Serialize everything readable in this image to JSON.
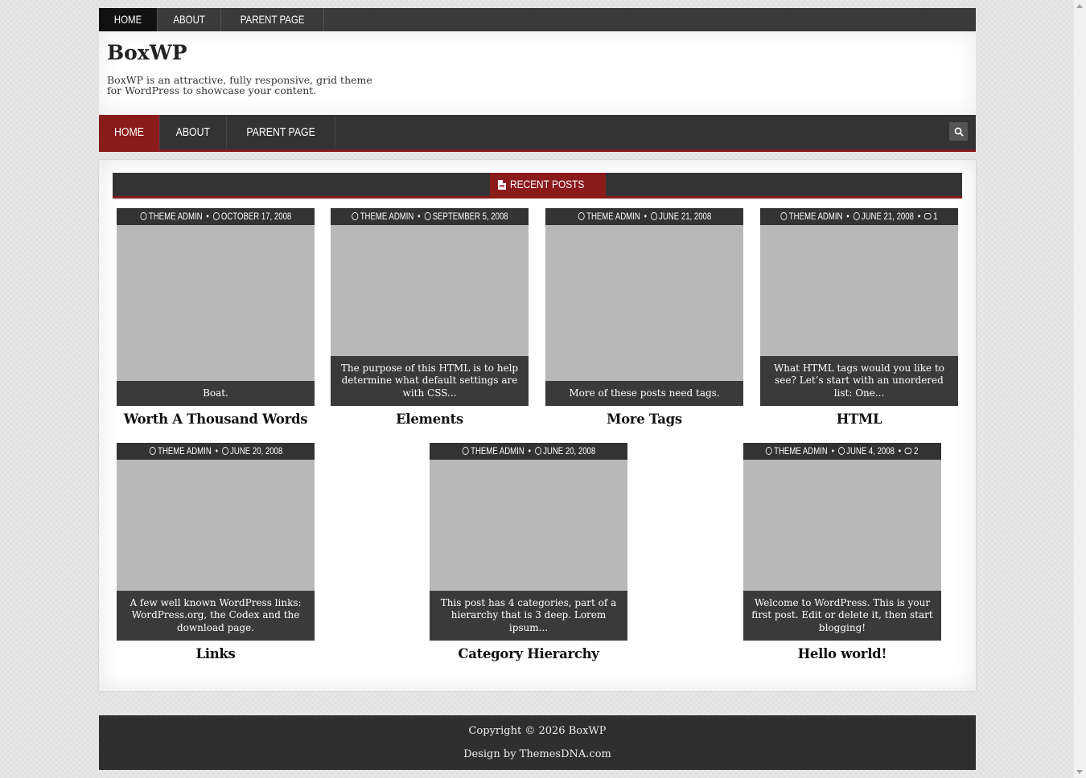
{
  "top_nav": {
    "items": [
      "HOME",
      "ABOUT",
      "PARENT PAGE"
    ]
  },
  "header": {
    "title": "BoxWP",
    "description": "BoxWP is an attractive, fully responsive, grid theme for WordPress to showcase your content."
  },
  "main_nav": {
    "items": [
      "HOME",
      "ABOUT",
      "PARENT PAGE"
    ],
    "search_icon": "search-icon"
  },
  "section": {
    "title": "RECENT POSTS",
    "icon": "document-icon"
  },
  "posts": [
    {
      "author": "THEME ADMIN",
      "date": "OCTOBER 17, 2008",
      "comments": "",
      "excerpt": "Boat.",
      "title": "Worth A Thousand Words"
    },
    {
      "author": "THEME ADMIN",
      "date": "SEPTEMBER 5, 2008",
      "comments": "",
      "excerpt": "The purpose of this HTML is to help determine what default settings are with CSS...",
      "title": "Elements"
    },
    {
      "author": "THEME ADMIN",
      "date": "JUNE 21, 2008",
      "comments": "",
      "excerpt": "More of these posts need tags.",
      "title": "More Tags"
    },
    {
      "author": "THEME ADMIN",
      "date": "JUNE 21, 2008",
      "comments": "1",
      "excerpt": "What HTML tags would you like to see? Let’s start with an unordered list: One...",
      "title": "HTML"
    },
    {
      "author": "THEME ADMIN",
      "date": "JUNE 20, 2008",
      "comments": "",
      "excerpt": "A few well known WordPress links: WordPress.org, the Codex and the download page.",
      "title": "Links"
    },
    {
      "author": "THEME ADMIN",
      "date": "JUNE 20, 2008",
      "comments": "",
      "excerpt": "This post has 4 categories, part of a hierarchy that is 3 deep. Lorem ipsum...",
      "title": "Category Hierarchy"
    },
    {
      "author": "THEME ADMIN",
      "date": "JUNE 4, 2008",
      "comments": "2",
      "excerpt": "Welcome to WordPress. This is your first post. Edit or delete it, then start blogging!",
      "title": "Hello world!"
    }
  ],
  "footer": {
    "copyright": "Copyright © 2026 BoxWP",
    "credit": "Design by ThemesDNA.com"
  },
  "colors": {
    "accent": "#8b1a1a",
    "dark": "#333333"
  }
}
